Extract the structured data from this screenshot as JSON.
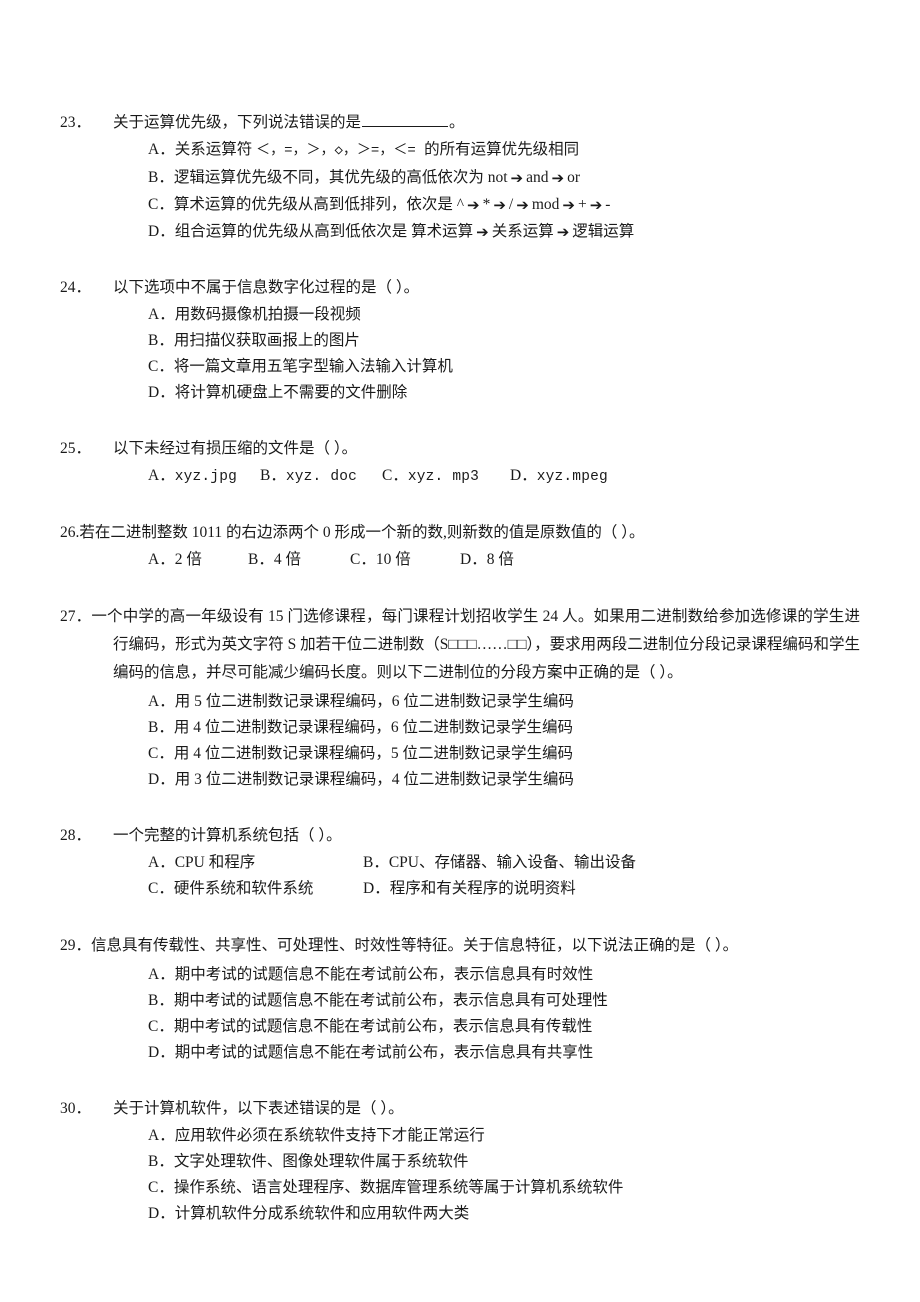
{
  "document": {
    "type": "exam-paper",
    "language": "zh-CN",
    "page_background": "#ffffff",
    "text_color": "#1a1a1a"
  },
  "questions": [
    {
      "number": "23．",
      "stem_before_blank": "关于运算优先级，下列说法错误的是",
      "stem_after_blank": "。",
      "options": [
        {
          "label": "A．",
          "pre": "关系运算符 ",
          "ops": "＜，=，＞，◇，＞=，＜= ",
          "post": "的所有运算优先级相同"
        },
        {
          "label": "B．",
          "pre": "逻辑运算优先级不同，其优先级的高低依次为 ",
          "seq": [
            "not",
            "and",
            "or"
          ],
          "post": ""
        },
        {
          "label": "C．",
          "pre": "算术运算的优先级从高到低排列，依次是 ",
          "seq": [
            "^",
            "*",
            "/",
            "mod",
            "+",
            "-"
          ],
          "post": ""
        },
        {
          "label": "D．",
          "pre": "组合运算的优先级从高到低依次是 ",
          "seq": [
            "算术运算",
            "关系运算",
            "逻辑运算"
          ],
          "post": ""
        }
      ]
    },
    {
      "number": "24．",
      "stem": "以下选项中不属于信息数字化过程的是（ ）。",
      "options": [
        {
          "label": "A．",
          "text": "用数码摄像机拍摄一段视频"
        },
        {
          "label": "B．",
          "text": "用扫描仪获取画报上的图片"
        },
        {
          "label": "C．",
          "text": "将一篇文章用五笔字型输入法输入计算机"
        },
        {
          "label": "D．",
          "text": "将计算机硬盘上不需要的文件删除"
        }
      ]
    },
    {
      "number": "25．",
      "stem": "以下未经过有损压缩的文件是（ ）。",
      "options_inline": [
        {
          "label": "A．",
          "text": "xyz.jpg"
        },
        {
          "label": "B．",
          "text": "xyz. doc"
        },
        {
          "label": "C．",
          "text": "xyz. mp3"
        },
        {
          "label": "D．",
          "text": "xyz.mpeg"
        }
      ]
    },
    {
      "number": "26.",
      "stem": "若在二进制整数 1011 的右边添两个 0 形成一个新的数,则新数的值是原数值的（   ）。",
      "options_inline": [
        {
          "label": "A．",
          "text": "2 倍"
        },
        {
          "label": "B．",
          "text": "4 倍"
        },
        {
          "label": "C．",
          "text": "10 倍"
        },
        {
          "label": "D．",
          "text": "8 倍"
        }
      ]
    },
    {
      "number": "27．",
      "stem": "一个中学的高一年级设有 15 门选修课程，每门课程计划招收学生 24 人。如果用二进制数给参加选修课的学生进行编码，形式为英文字符 S 加若干位二进制数（S□□□……□□），要求用两段二进制位分段记录课程编码和学生编码的信息，并尽可能减少编码长度。则以下二进制位的分段方案中正确的是（ ）。",
      "options": [
        {
          "label": "A．",
          "text": "用 5 位二进制数记录课程编码，6 位二进制数记录学生编码"
        },
        {
          "label": "B．",
          "text": "用 4 位二进制数记录课程编码，6 位二进制数记录学生编码"
        },
        {
          "label": "C．",
          "text": "用 4 位二进制数记录课程编码，5 位二进制数记录学生编码"
        },
        {
          "label": "D．",
          "text": "用 3 位二进制数记录课程编码，4 位二进制数记录学生编码"
        }
      ]
    },
    {
      "number": "28．",
      "stem": "一个完整的计算机系统包括（ ）。",
      "options_grid": [
        {
          "labelA": "A．",
          "textA": "CPU 和程序",
          "labelB": "B．",
          "textB": "CPU、存储器、输入设备、输出设备"
        },
        {
          "labelA": "C．",
          "textA": "硬件系统和软件系统",
          "labelB": "D．",
          "textB": "程序和有关程序的说明资料"
        }
      ]
    },
    {
      "number": "29．",
      "stem": "信息具有传载性、共享性、可处理性、时效性等特征。关于信息特征，以下说法正确的是（ ）。",
      "options": [
        {
          "label": "A．",
          "text": "期中考试的试题信息不能在考试前公布，表示信息具有时效性"
        },
        {
          "label": "B．",
          "text": "期中考试的试题信息不能在考试前公布，表示信息具有可处理性"
        },
        {
          "label": "C．",
          "text": "期中考试的试题信息不能在考试前公布，表示信息具有传载性"
        },
        {
          "label": "D．",
          "text": "期中考试的试题信息不能在考试前公布，表示信息具有共享性"
        }
      ]
    },
    {
      "number": "30．",
      "stem": "关于计算机软件，以下表述错误的是（ ）。",
      "options": [
        {
          "label": "A．",
          "text": "应用软件必须在系统软件支持下才能正常运行"
        },
        {
          "label": "B．",
          "text": "文字处理软件、图像处理软件属于系统软件"
        },
        {
          "label": "C．",
          "text": "操作系统、语言处理程序、数据库管理系统等属于计算机系统软件"
        },
        {
          "label": "D．",
          "text": "计算机软件分成系统软件和应用软件两大类"
        }
      ]
    }
  ],
  "glyphs": {
    "arrow": "➔",
    "box": "□"
  }
}
